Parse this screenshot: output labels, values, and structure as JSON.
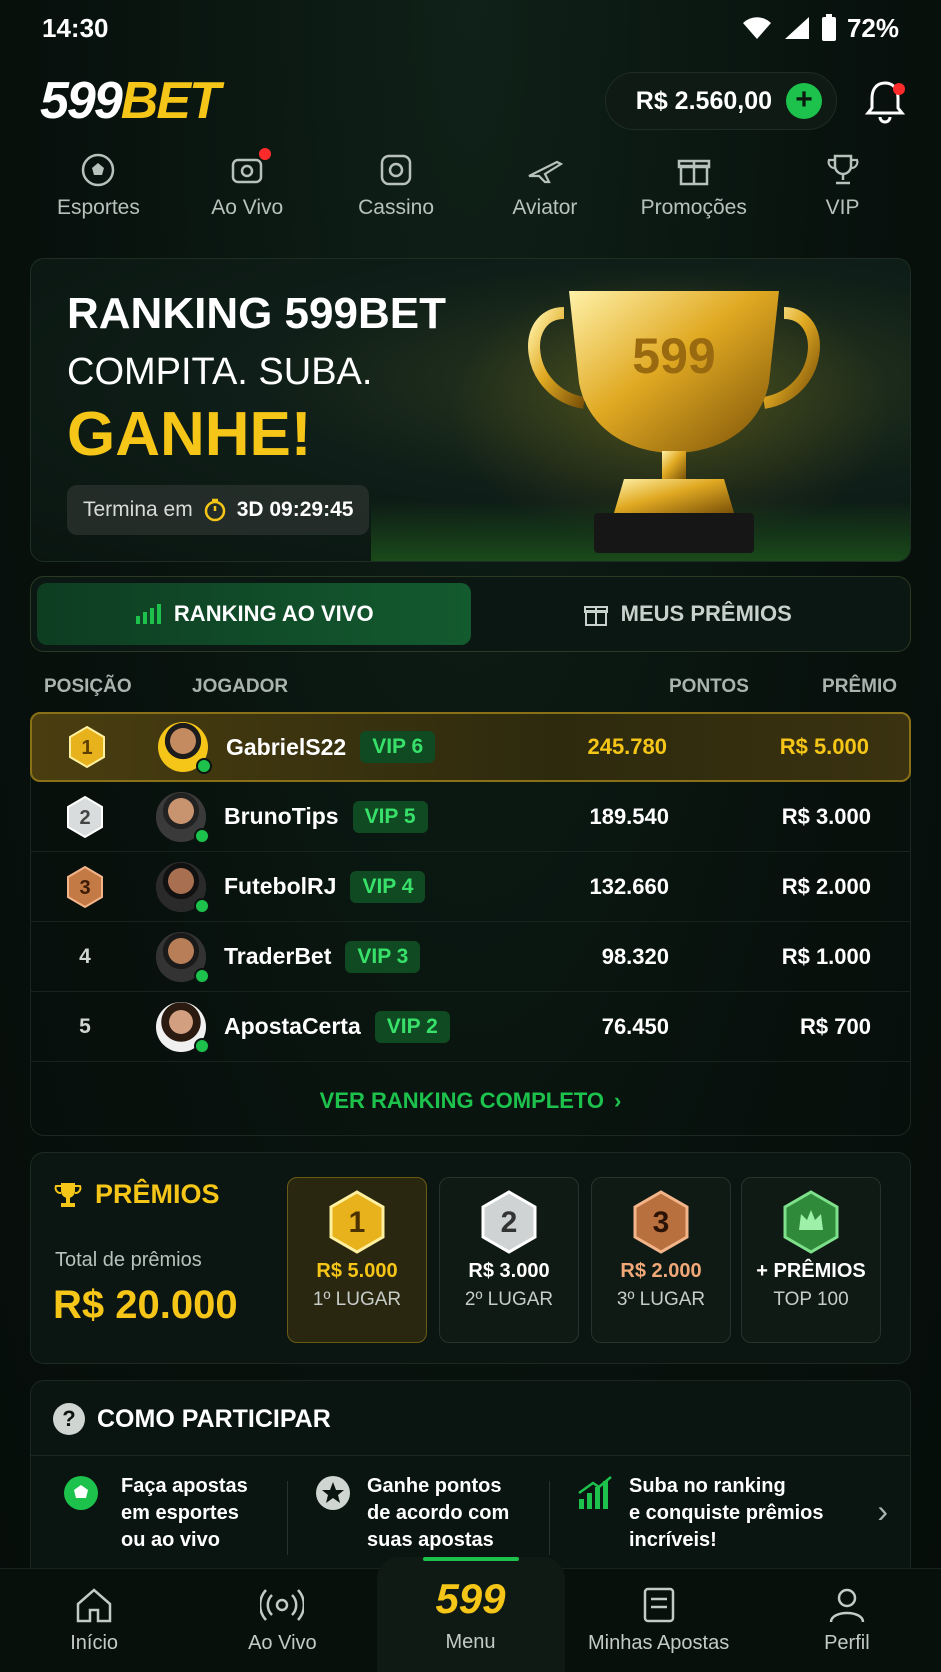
{
  "status": {
    "time": "14:30",
    "battery": "72%"
  },
  "header": {
    "logo_white": "599",
    "logo_yellow": "BET",
    "balance": "R$ 2.560,00"
  },
  "nav": [
    {
      "label": "Esportes",
      "icon": "soccer-ball-icon"
    },
    {
      "label": "Ao Vivo",
      "icon": "live-camera-icon"
    },
    {
      "label": "Cassino",
      "icon": "casino-chip-icon"
    },
    {
      "label": "Aviator",
      "icon": "airplane-icon"
    },
    {
      "label": "Promoções",
      "icon": "gift-icon"
    },
    {
      "label": "VIP",
      "icon": "trophy-icon"
    }
  ],
  "banner": {
    "title": "RANKING 599BET",
    "subtitle": "COMPITA. SUBA.",
    "highlight": "GANHE!",
    "countdown_label": "Termina em",
    "countdown_value": "3D 09:29:45",
    "trophy_text": "599"
  },
  "tabs": [
    {
      "label": "RANKING AO VIVO",
      "active": true
    },
    {
      "label": "MEUS PRÊMIOS",
      "active": false
    }
  ],
  "table": {
    "columns": [
      "POSIÇÃO",
      "JOGADOR",
      "PONTOS",
      "PRÊMIO"
    ],
    "rows": [
      {
        "pos": "1",
        "name": "GabrielS22",
        "vip": "VIP 6",
        "points": "245.780",
        "prize": "R$ 5.000"
      },
      {
        "pos": "2",
        "name": "BrunoTips",
        "vip": "VIP 5",
        "points": "189.540",
        "prize": "R$ 3.000"
      },
      {
        "pos": "3",
        "name": "FutebolRJ",
        "vip": "VIP 4",
        "points": "132.660",
        "prize": "R$ 2.000"
      },
      {
        "pos": "4",
        "name": "TraderBet",
        "vip": "VIP 3",
        "points": "98.320",
        "prize": "R$ 1.000"
      },
      {
        "pos": "5",
        "name": "ApostaCerta",
        "vip": "VIP 2",
        "points": "76.450",
        "prize": "R$ 700"
      }
    ],
    "see_all": "VER RANKING COMPLETO"
  },
  "prizes": {
    "title": "PRÊMIOS",
    "total_label": "Total de prêmios",
    "total": "R$ 20.000",
    "cards": [
      {
        "badge": "1",
        "amount": "R$ 5.000",
        "label": "1º LUGAR",
        "color": "#f5c518"
      },
      {
        "badge": "2",
        "amount": "R$ 3.000",
        "label": "2º LUGAR",
        "color": "#ffffff"
      },
      {
        "badge": "3",
        "amount": "R$ 2.000",
        "label": "3º LUGAR",
        "color": "#f0a878"
      },
      {
        "badge": "",
        "amount": "+ PRÊMIOS",
        "label": "TOP 100",
        "color": "#ffffff"
      }
    ]
  },
  "howto": {
    "title": "COMO PARTICIPAR",
    "steps": [
      {
        "line1": "Faça apostas",
        "line2": "em esportes",
        "line3": "ou ao vivo"
      },
      {
        "line1": "Ganhe pontos",
        "line2": "de acordo com",
        "line3": "suas apostas"
      },
      {
        "line1": "Suba no ranking",
        "line2": "e conquiste prêmios",
        "line3": "incríveis!"
      }
    ]
  },
  "bottomnav": {
    "home": "Início",
    "live": "Ao Vivo",
    "menu_num": "599",
    "menu": "Menu",
    "bets": "Minhas Apostas",
    "profile": "Perfil"
  },
  "colors": {
    "accent": "#1dc24d",
    "gold": "#f5c518",
    "background": "#08110d"
  }
}
